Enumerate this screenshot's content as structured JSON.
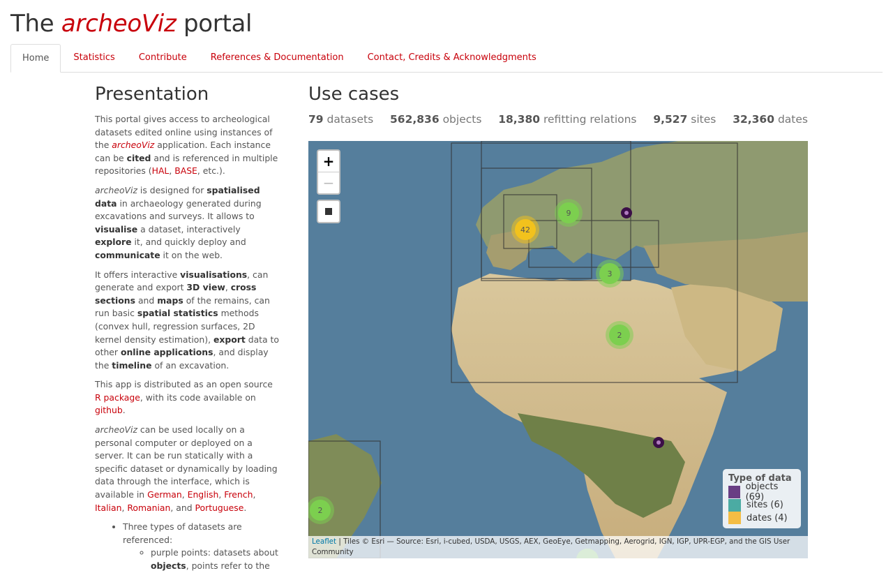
{
  "header": {
    "title_pre": "The",
    "title_em": "archeoViz",
    "title_post": "portal"
  },
  "nav": {
    "tabs": [
      "Home",
      "Statistics",
      "Contribute",
      "References & Documentation",
      "Contact, Credits & Acknowledgments"
    ]
  },
  "presentation": {
    "title": "Presentation",
    "p1": {
      "t1": "This portal gives access to archeological datasets edited online using instances of the ",
      "em": "archeoViz",
      "t2": " application. Each instance can be ",
      "b1": "cited",
      "t3": " and is referenced in multiple repositories (",
      "l1": "HAL",
      "t4": ", ",
      "l2": "BASE",
      "t5": ", etc.)."
    },
    "p2": {
      "em": "archeoViz",
      "t1": " is designed for ",
      "b1": "spatialised data",
      "t2": " in archaeology generated during excavations and surveys. It allows to ",
      "b2": "visualise",
      "t3": " a dataset, interactively ",
      "b3": "explore",
      "t4": " it, and quickly deploy and ",
      "b4": "communicate",
      "t5": " it on the web."
    },
    "p3": {
      "t1": "It offers interactive ",
      "b1": "visualisations",
      "t2": ", can generate and export ",
      "b2": "3D view",
      "t3": ", ",
      "b3": "cross sections",
      "t4": " and ",
      "b4": "maps",
      "t5": " of the remains, can run basic ",
      "b5": "spatial statistics",
      "t6": " methods (convex hull, regression surfaces, 2D kernel density estimation), ",
      "b6": "export",
      "t7": " data to other ",
      "b7": "online applications",
      "t8": ", and display the ",
      "b8": "timeline",
      "t9": " of an excavation."
    },
    "p4": {
      "t1": "This app is distributed as an open source ",
      "l1": "R package",
      "t2": ", with its code available on ",
      "l2": "github",
      "t3": "."
    },
    "p5": {
      "em": "archeoViz",
      "t1": " can be used locally on a personal computer or deployed on a server. It can be run statically with a specific dataset or dynamically by loading data through the interface, which is available in ",
      "l1": "German",
      "s1": ", ",
      "l2": "English",
      "s2": ", ",
      "l3": "French",
      "s3": ", ",
      "l4": "Italian",
      "s4": ", ",
      "l5": "Romanian",
      "s5": ", and ",
      "l6": "Portuguese",
      "s6": "."
    },
    "list": {
      "item1": "Three types of datasets are referenced:",
      "sub1_t1": "purple points: datasets about ",
      "sub1_b1": "objects",
      "sub1_t2": ", points refer to the"
    }
  },
  "usecases": {
    "title": "Use cases",
    "stats": [
      {
        "value": "79",
        "label": "datasets"
      },
      {
        "value": "562,836",
        "label": "objects"
      },
      {
        "value": "18,380",
        "label": "refitting relations"
      },
      {
        "value": "9,527",
        "label": "sites"
      },
      {
        "value": "32,360",
        "label": "dates"
      }
    ]
  },
  "map": {
    "zoom_in": "+",
    "zoom_out": "−",
    "clusters": [
      {
        "label": "42",
        "kind": "dates"
      },
      {
        "label": "9",
        "kind": "sites"
      },
      {
        "label": "3",
        "kind": "sites"
      },
      {
        "label": "2",
        "kind": "sites"
      },
      {
        "label": "2",
        "kind": "sites"
      }
    ],
    "legend": {
      "title": "Type of data",
      "items": [
        {
          "label": "objects (69)",
          "color": "#5b2a78"
        },
        {
          "label": "sites (6)",
          "color": "#3aa39a"
        },
        {
          "label": "dates (4)",
          "color": "#f5b731"
        }
      ]
    },
    "attribution": {
      "link": "Leaflet",
      "text": " | Tiles © Esri — Source: Esri, i-cubed, USDA, USGS, AEX, GeoEye, Getmapping, Aerogrid, IGN, IGP, UPR-EGP, and the GIS User Community"
    },
    "colors": {
      "ocean": "#557e9c",
      "land": "#c9b78a",
      "cluster_green": "#7ccf4f",
      "cluster_yellow": "#f2c21d",
      "point": "#3b0f47"
    }
  }
}
